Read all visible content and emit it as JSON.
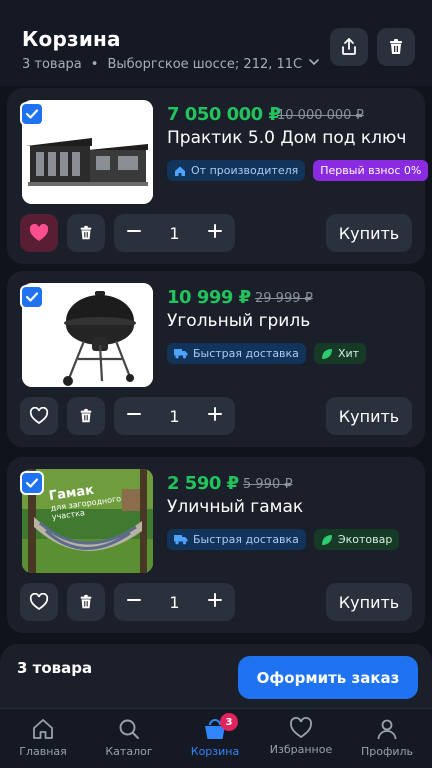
{
  "header": {
    "title": "Корзина",
    "item_count": "3 товара",
    "separator": "•",
    "address": "Выборгское шоссе; 212, 11С"
  },
  "items": [
    {
      "price": "7 050 000 ₽",
      "old_price": "10 000 000 ₽",
      "name": "Практик 5.0 Дом под ключ",
      "badges": [
        {
          "text": "От производителя",
          "style": "blue",
          "icon": "house-icon"
        },
        {
          "text": "Первый взнос 0%",
          "style": "purple",
          "icon": ""
        }
      ],
      "quantity": "1",
      "buy_label": "Купить",
      "favorite": true,
      "checked": true
    },
    {
      "price": "10 999 ₽",
      "old_price": "29 999 ₽",
      "name": "Угольный гриль",
      "badges": [
        {
          "text": "Быстрая доставка",
          "style": "blue",
          "icon": "truck-icon"
        },
        {
          "text": "Хит",
          "style": "green",
          "icon": "leaf-icon"
        }
      ],
      "quantity": "1",
      "buy_label": "Купить",
      "favorite": false,
      "checked": true
    },
    {
      "price": "2 590 ₽",
      "old_price": "5 990 ₽",
      "name": "Уличный гамак",
      "image_text": [
        "Гамак",
        "для загородного",
        "участка"
      ],
      "badges": [
        {
          "text": "Быстрая доставка",
          "style": "blue",
          "icon": "truck-icon"
        },
        {
          "text": "Экотовар",
          "style": "green",
          "icon": "leaf-icon"
        }
      ],
      "quantity": "1",
      "buy_label": "Купить",
      "favorite": false,
      "checked": true
    }
  ],
  "summary": {
    "count": "3 товара",
    "checkout_label": "Оформить заказ"
  },
  "nav": {
    "items": [
      {
        "label": "Главная",
        "icon": "home-icon"
      },
      {
        "label": "Каталог",
        "icon": "search-icon"
      },
      {
        "label": "Корзина",
        "icon": "cart-icon",
        "badge": "3",
        "active": true
      },
      {
        "label": "Избранное",
        "icon": "heart-icon"
      },
      {
        "label": "Профиль",
        "icon": "profile-icon"
      }
    ]
  },
  "colors": {
    "accent": "#1f73f0",
    "price_green": "#22c25c",
    "favorite_pink": "#ff4f8f",
    "badge_purple": "#8a2be2"
  }
}
